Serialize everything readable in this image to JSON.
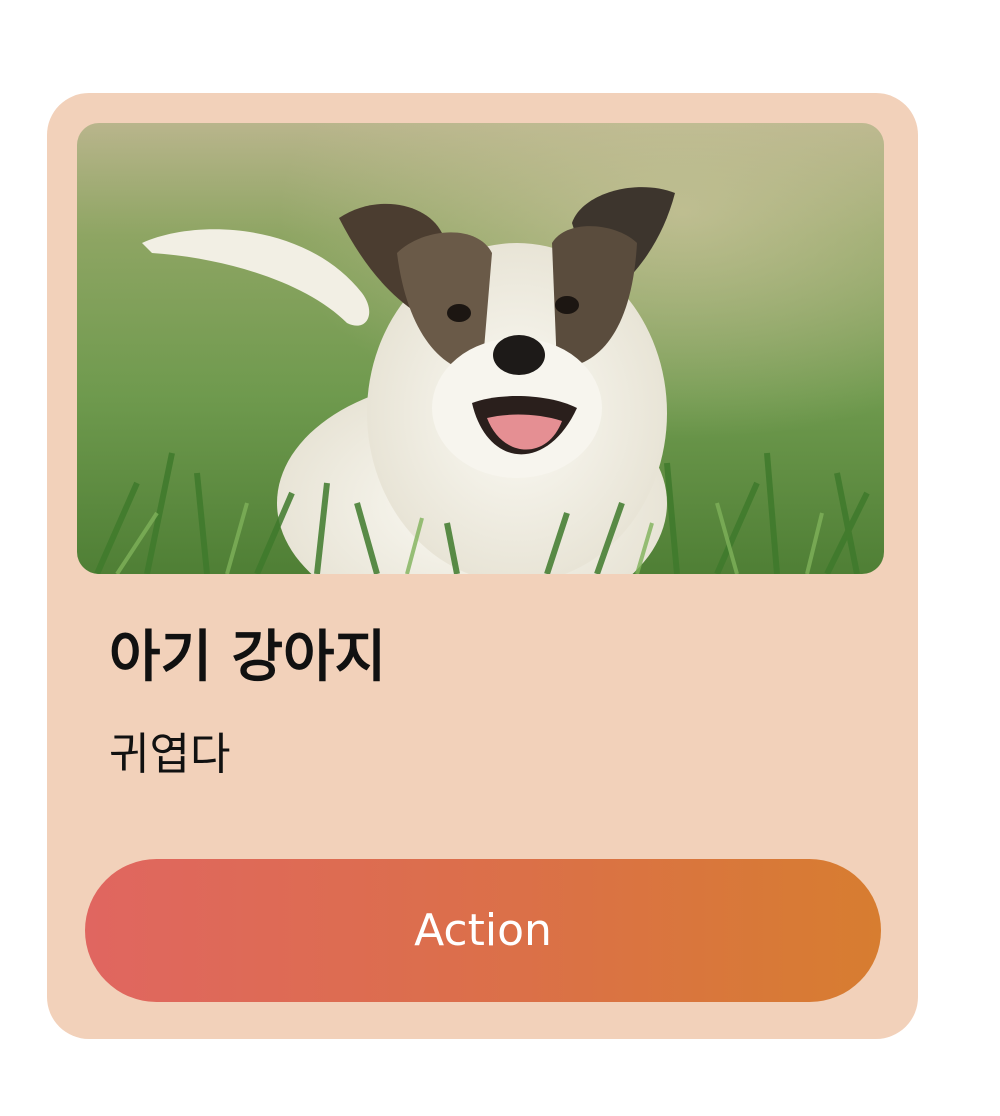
{
  "card": {
    "image": {
      "description_icon": "puppy-photo"
    },
    "title": "아기 강아지",
    "subtitle": "귀엽다",
    "action_label": "Action"
  },
  "colors": {
    "page_background": "#ffffff",
    "card_background": "#f2d1ba",
    "button_gradient_start": "#e06660",
    "button_gradient_end": "#d77d30",
    "button_text": "#ffffff",
    "title_text": "#111111"
  }
}
